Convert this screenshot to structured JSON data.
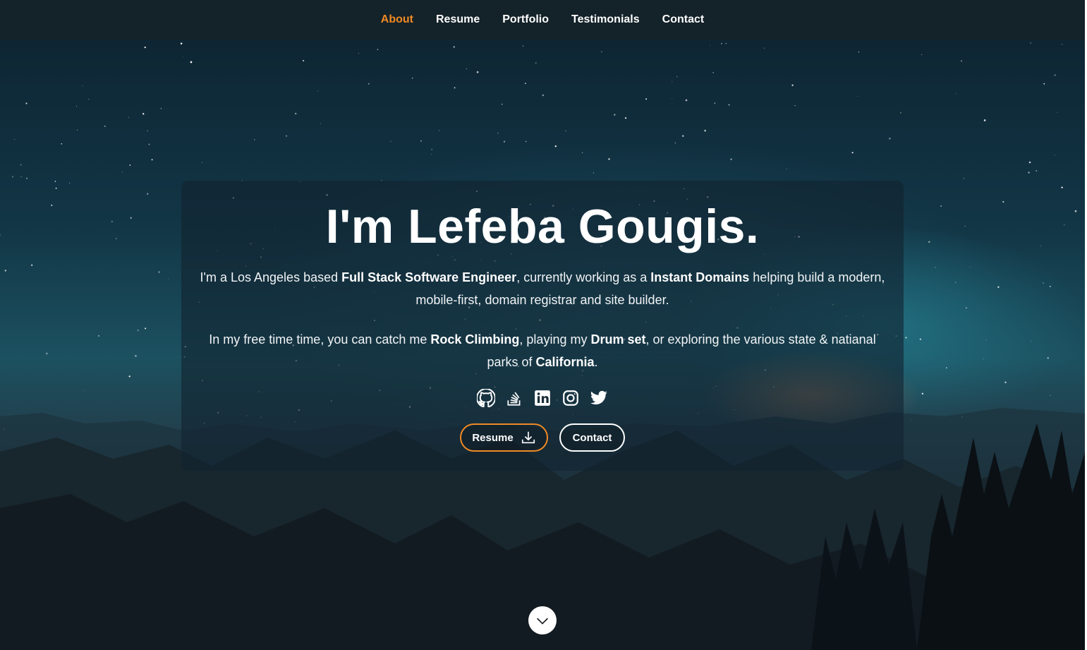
{
  "nav": {
    "items": [
      {
        "label": "About",
        "active": true
      },
      {
        "label": "Resume",
        "active": false
      },
      {
        "label": "Portfolio",
        "active": false
      },
      {
        "label": "Testimonials",
        "active": false
      },
      {
        "label": "Contact",
        "active": false
      }
    ]
  },
  "hero": {
    "title": "I'm Lefeba Gougis.",
    "intro": {
      "t1": "I'm a Los Angeles based ",
      "role": "Full Stack Software Engineer",
      "t2": ", currently working as a ",
      "company": "Instant Domains",
      "t3": " helping build a modern, mobile-first, domain registrar and site builder."
    },
    "hobbies": {
      "t1": "In my free time time, you can catch me ",
      "h1": "Rock Climbing",
      "t2": ", playing my ",
      "h2": "Drum set",
      "t3": ", or exploring the various state & natianal parks of ",
      "place": "California",
      "t4": "."
    },
    "socials": [
      "github-icon",
      "stack-overflow-icon",
      "linkedin-icon",
      "instagram-icon",
      "twitter-icon"
    ],
    "buttons": {
      "resume_label": "Resume",
      "contact_label": "Contact"
    }
  },
  "colors": {
    "accent": "#f08a24",
    "nav_bg": "#142229",
    "text": "#ffffff"
  }
}
